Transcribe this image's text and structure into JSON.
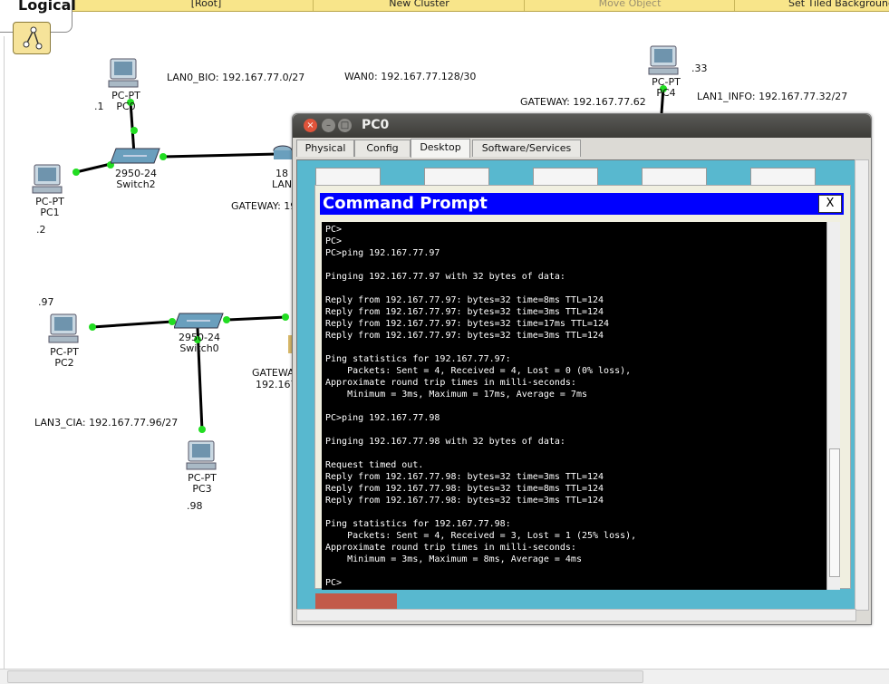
{
  "toolbar": {
    "view_label": "Logical",
    "items": [
      "[Root]",
      "New Cluster",
      "Move Object",
      "Set Tiled Background"
    ]
  },
  "network": {
    "devices": [
      {
        "model": "PC-PT",
        "name": "PC0",
        "addr": ".1"
      },
      {
        "model": "PC-PT",
        "name": "PC1",
        "addr": ".2"
      },
      {
        "model": "PC-PT",
        "name": "PC2",
        "addr": ".97"
      },
      {
        "model": "PC-PT",
        "name": "PC3",
        "addr": ".98"
      },
      {
        "model": "PC-PT",
        "name": "PC4",
        "addr": ".33"
      },
      {
        "model": "2950-24",
        "name": "Switch2"
      },
      {
        "model": "2950-24",
        "name": "Switch0"
      },
      {
        "model": "18",
        "name": "LAN"
      }
    ],
    "labels": {
      "lan0": "LAN0_BIO: 192.167.77.0/27",
      "wan0": "WAN0: 192.167.77.128/30",
      "gw_lan1": "GATEWAY: 192.167.77.62",
      "lan1": "LAN1_INFO: 192.167.77.32/27",
      "gw_lan0": "GATEWAY: 19",
      "gw_lan3": "GATEWA",
      "gw_lan3_addr": "192.167",
      "lan3": "LAN3_CIA: 192.167.77.96/27"
    }
  },
  "window": {
    "title": "PC0",
    "tabs": [
      "Physical",
      "Config",
      "Desktop",
      "Software/Services"
    ],
    "active_tab": "Desktop"
  },
  "command_prompt": {
    "title": "Command Prompt",
    "close_label": "X",
    "output": "PC>\nPC>\nPC>ping 192.167.77.97\n\nPinging 192.167.77.97 with 32 bytes of data:\n\nReply from 192.167.77.97: bytes=32 time=8ms TTL=124\nReply from 192.167.77.97: bytes=32 time=3ms TTL=124\nReply from 192.167.77.97: bytes=32 time=17ms TTL=124\nReply from 192.167.77.97: bytes=32 time=3ms TTL=124\n\nPing statistics for 192.167.77.97:\n    Packets: Sent = 4, Received = 4, Lost = 0 (0% loss),\nApproximate round trip times in milli-seconds:\n    Minimum = 3ms, Maximum = 17ms, Average = 7ms\n\nPC>ping 192.167.77.98\n\nPinging 192.167.77.98 with 32 bytes of data:\n\nRequest timed out.\nReply from 192.167.77.98: bytes=32 time=3ms TTL=124\nReply from 192.167.77.98: bytes=32 time=8ms TTL=124\nReply from 192.167.77.98: bytes=32 time=3ms TTL=124\n\nPing statistics for 192.167.77.98:\n    Packets: Sent = 4, Received = 3, Lost = 1 (25% loss),\nApproximate round trip times in milli-seconds:\n    Minimum = 3ms, Maximum = 8ms, Average = 4ms\n\nPC>"
  },
  "colors": {
    "toolbar": "#f8e58a",
    "link_dot": "#22dd22",
    "cmd_title": "#0000ff",
    "desktop_bg": "#58b8cf"
  }
}
